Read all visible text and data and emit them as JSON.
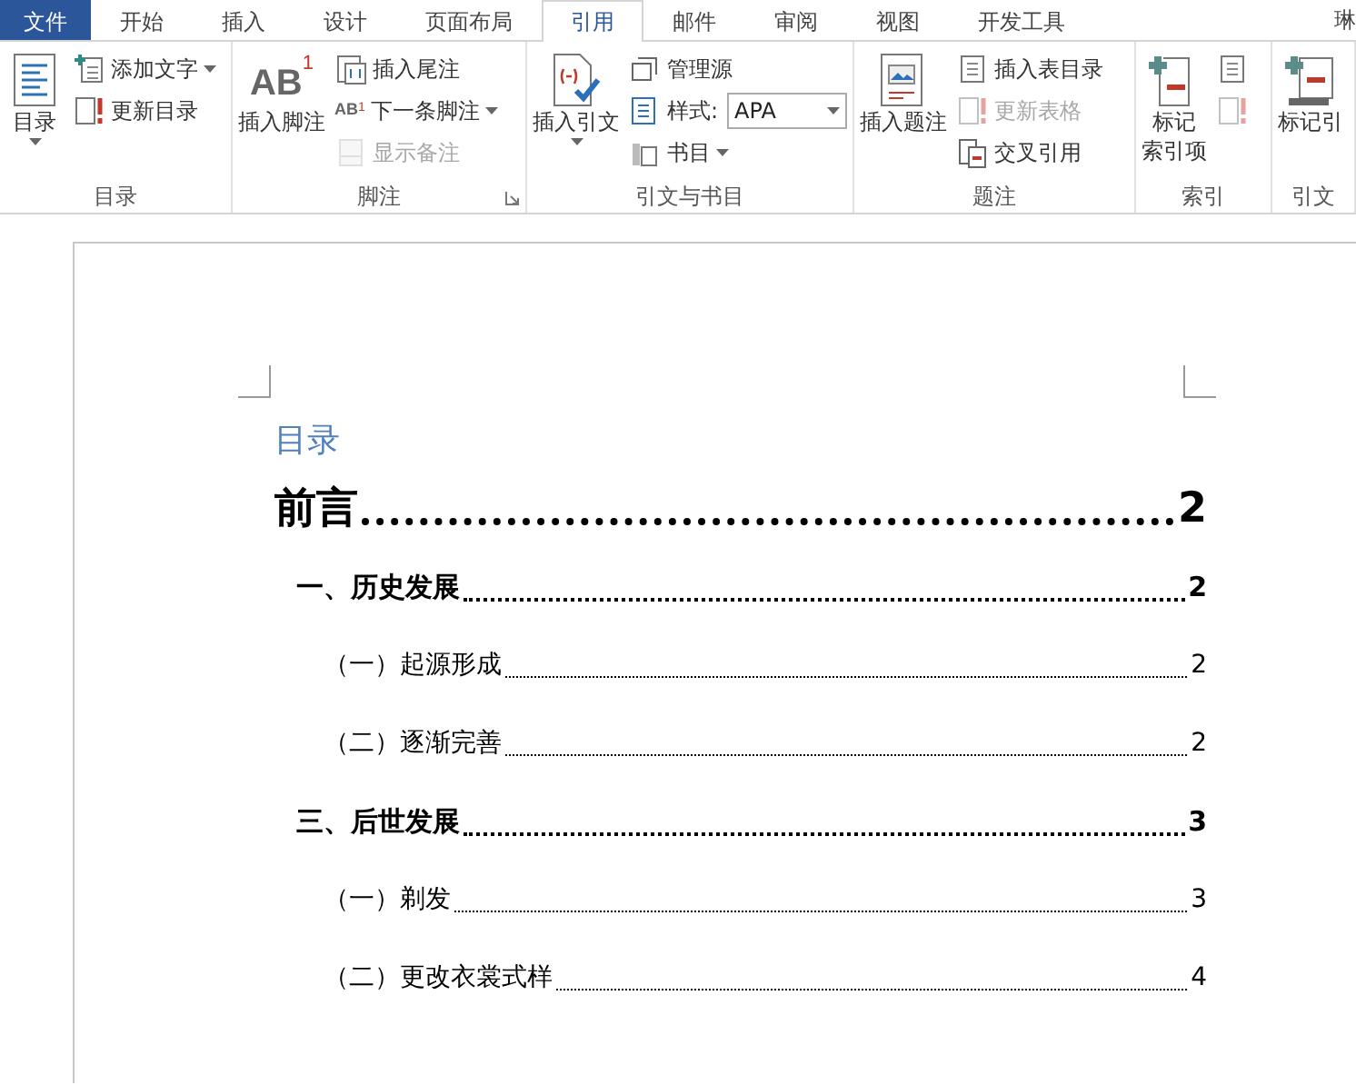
{
  "tabs": [
    {
      "label": "文件",
      "kind": "file",
      "selected": false
    },
    {
      "label": "开始",
      "kind": "tab",
      "selected": false
    },
    {
      "label": "插入",
      "kind": "tab",
      "selected": false
    },
    {
      "label": "设计",
      "kind": "tab",
      "selected": false
    },
    {
      "label": "页面布局",
      "kind": "tab",
      "selected": false
    },
    {
      "label": "引用",
      "kind": "tab",
      "selected": true
    },
    {
      "label": "邮件",
      "kind": "tab",
      "selected": false
    },
    {
      "label": "审阅",
      "kind": "tab",
      "selected": false
    },
    {
      "label": "视图",
      "kind": "tab",
      "selected": false
    },
    {
      "label": "开发工具",
      "kind": "tab",
      "selected": false
    }
  ],
  "user": "琳",
  "groups": [
    {
      "label": "目录",
      "launcher": false,
      "items": [
        {
          "kind": "large",
          "lines": [
            "目录"
          ],
          "dropdown": true,
          "disabled": false
        },
        {
          "kind": "column",
          "items": [
            {
              "label": "添加文字",
              "dropdown": true,
              "disabled": false
            },
            {
              "label": "更新目录",
              "dropdown": false,
              "disabled": false
            }
          ]
        }
      ]
    },
    {
      "label": "脚注",
      "launcher": true,
      "items": [
        {
          "kind": "large",
          "icon_text": "AB",
          "icon_sup": "1",
          "lines": [
            "插入脚注"
          ],
          "dropdown": false,
          "disabled": false
        },
        {
          "kind": "column",
          "items": [
            {
              "label": "插入尾注",
              "dropdown": false,
              "disabled": false
            },
            {
              "icon_text": "AB",
              "icon_sup": "1",
              "label": "下一条脚注",
              "dropdown": true,
              "disabled": false
            },
            {
              "label": "显示备注",
              "dropdown": false,
              "disabled": true
            }
          ]
        }
      ]
    },
    {
      "label": "引文与书目",
      "launcher": false,
      "items": [
        {
          "kind": "large",
          "lines": [
            "插入引文"
          ],
          "dropdown": true,
          "disabled": false
        },
        {
          "kind": "column",
          "items": [
            {
              "label": "管理源",
              "dropdown": false,
              "disabled": false
            },
            {
              "label": "样式:",
              "combo": "APA",
              "dropdown": true,
              "disabled": false
            },
            {
              "label": "书目",
              "dropdown": true,
              "disabled": false
            }
          ]
        }
      ]
    },
    {
      "label": "题注",
      "launcher": false,
      "items": [
        {
          "kind": "large",
          "lines": [
            "插入题注"
          ],
          "dropdown": false,
          "disabled": false
        },
        {
          "kind": "column",
          "items": [
            {
              "label": "插入表目录",
              "dropdown": false,
              "disabled": false
            },
            {
              "label": "更新表格",
              "dropdown": false,
              "disabled": true
            },
            {
              "label": "交叉引用",
              "dropdown": false,
              "disabled": false
            }
          ]
        }
      ]
    },
    {
      "label": "索引",
      "launcher": false,
      "items": [
        {
          "kind": "large",
          "lines": [
            "标记",
            "索引项"
          ],
          "dropdown": false,
          "disabled": false
        },
        {
          "kind": "column",
          "items": [
            {
              "dropdown": false,
              "disabled": false
            },
            {
              "dropdown": false,
              "disabled": true
            }
          ]
        }
      ]
    },
    {
      "label": "引文",
      "launcher": false,
      "items": [
        {
          "kind": "large",
          "lines": [
            "标记引"
          ],
          "dropdown": false,
          "disabled": false
        }
      ]
    }
  ],
  "document": {
    "toc_heading": "目录",
    "entries": [
      {
        "text": "前言",
        "page": "2",
        "children": [
          {
            "text": "一、历史发展",
            "page": "2",
            "children": [
              {
                "text": "（一）起源形成",
                "page": "2"
              },
              {
                "text": "（二）逐渐完善",
                "page": "2"
              }
            ]
          },
          {
            "text": "三、后世发展",
            "page": "3",
            "children": [
              {
                "text": "（一）剃发",
                "page": "3"
              },
              {
                "text": "（二）更改衣裳式样",
                "page": "4"
              }
            ]
          }
        ]
      }
    ]
  }
}
